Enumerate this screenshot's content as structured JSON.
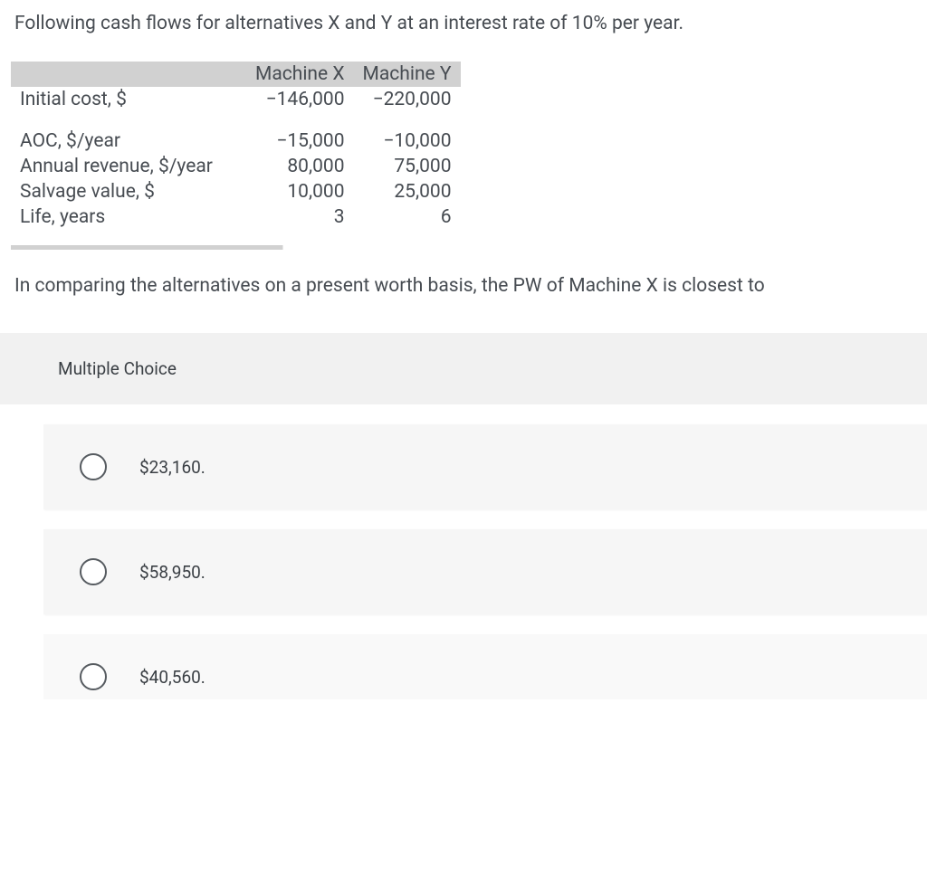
{
  "intro": "Following cash flows for alternatives X and Y at an interest rate of 10% per year.",
  "table": {
    "header": {
      "col0": "",
      "col1": "Machine X",
      "col2": "Machine Y"
    },
    "rows1": [
      {
        "label": "Initial cost, $",
        "x": "−146,000",
        "y": "−220,000"
      }
    ],
    "rows2": [
      {
        "label": "AOC, $/year",
        "x": "−15,000",
        "y": "−10,000"
      },
      {
        "label": "Annual revenue, $/year",
        "x": "80,000",
        "y": "75,000"
      },
      {
        "label": "Salvage value, $",
        "x": "10,000",
        "y": "25,000"
      },
      {
        "label": "Life, years",
        "x": "3",
        "y": "6"
      }
    ]
  },
  "question": "In comparing the alternatives on a present worth basis, the PW of Machine X is closest to",
  "mc_title": "Multiple Choice",
  "options": [
    {
      "label": "$23,160."
    },
    {
      "label": "$58,950."
    },
    {
      "label": "$40,560."
    }
  ]
}
